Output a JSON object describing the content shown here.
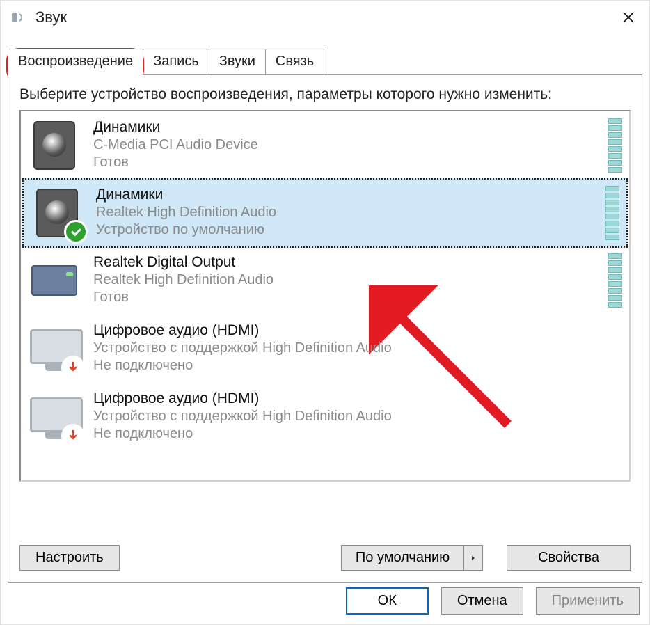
{
  "window": {
    "title": "Звук"
  },
  "tabs": [
    {
      "label": "Воспроизведение",
      "active": true
    },
    {
      "label": "Запись"
    },
    {
      "label": "Звуки"
    },
    {
      "label": "Связь"
    }
  ],
  "instruction": "Выберите устройство воспроизведения, параметры которого нужно изменить:",
  "devices": [
    {
      "name": "Динамики",
      "desc": "C-Media PCI Audio Device",
      "status": "Готов",
      "icon": "speaker",
      "badge": null,
      "selected": false,
      "meter": true
    },
    {
      "name": "Динамики",
      "desc": "Realtek High Definition Audio",
      "status": "Устройство по умолчанию",
      "icon": "speaker",
      "badge": "check",
      "selected": true,
      "meter": true
    },
    {
      "name": "Realtek Digital Output",
      "desc": "Realtek High Definition Audio",
      "status": "Готов",
      "icon": "spdif",
      "badge": null,
      "selected": false,
      "meter": true
    },
    {
      "name": "Цифровое аудио (HDMI)",
      "desc": "Устройство с поддержкой High Definition Audio",
      "status": "Не подключено",
      "icon": "monitor",
      "badge": "down",
      "selected": false,
      "meter": false
    },
    {
      "name": "Цифровое аудио (HDMI)",
      "desc": "Устройство с поддержкой High Definition Audio",
      "status": "Не подключено",
      "icon": "monitor",
      "badge": "down",
      "selected": false,
      "meter": false
    }
  ],
  "buttons": {
    "configure": "Настроить",
    "set_default": "По умолчанию",
    "properties": "Свойства",
    "ok": "ОК",
    "cancel": "Отмена",
    "apply": "Применить"
  }
}
